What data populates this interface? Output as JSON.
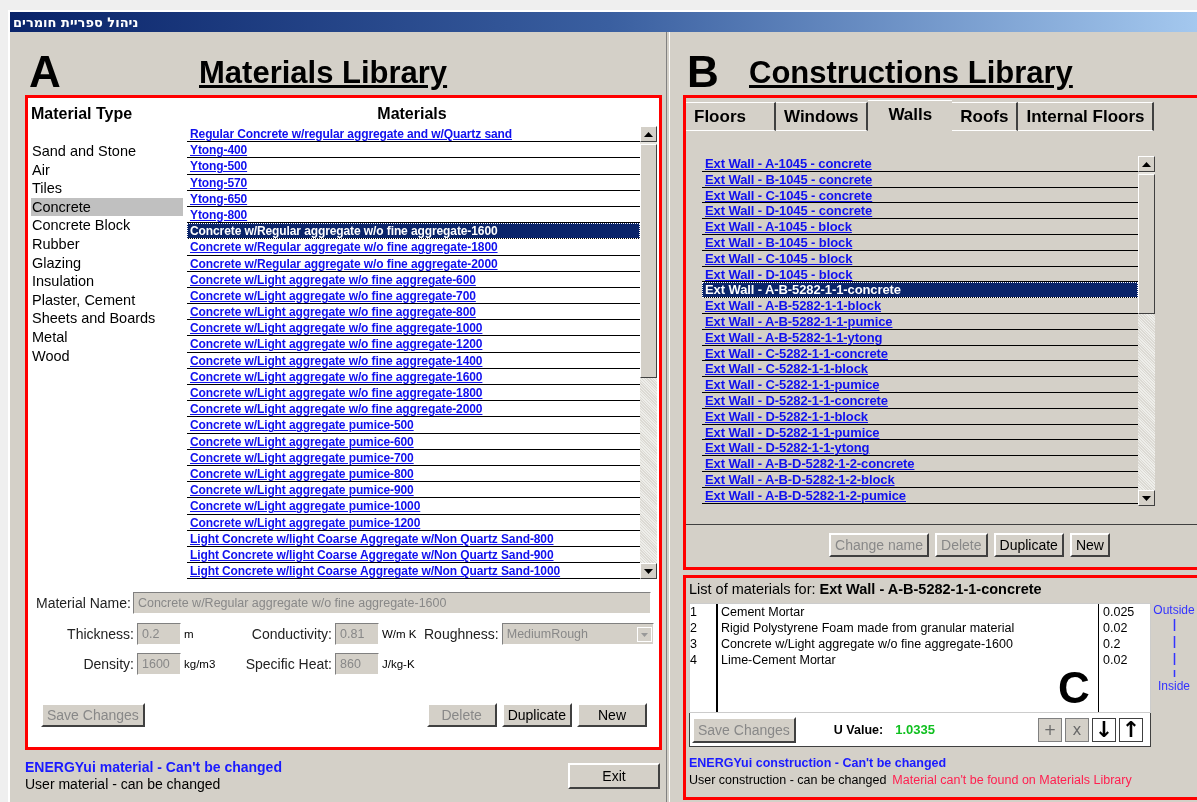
{
  "window": {
    "title": "ניהול ספריית חומרים"
  },
  "materials_library": {
    "letter": "A",
    "title": "Materials Library",
    "type_heading": "Material Type",
    "list_heading": "Materials",
    "types": [
      {
        "label": "Sand and Stone",
        "selected": false
      },
      {
        "label": "Air",
        "selected": false
      },
      {
        "label": "Tiles",
        "selected": false
      },
      {
        "label": "Concrete",
        "selected": true
      },
      {
        "label": "Concrete Block",
        "selected": false
      },
      {
        "label": "Rubber",
        "selected": false
      },
      {
        "label": "Glazing",
        "selected": false
      },
      {
        "label": "Insulation",
        "selected": false
      },
      {
        "label": "Plaster, Cement",
        "selected": false
      },
      {
        "label": "Sheets and Boards",
        "selected": false
      },
      {
        "label": "Metal",
        "selected": false
      },
      {
        "label": "Wood",
        "selected": false
      }
    ],
    "materials": [
      {
        "label": "Regular Concrete w/regular aggregate and w/Quartz sand",
        "selected": false
      },
      {
        "label": "Ytong-400",
        "selected": false
      },
      {
        "label": "Ytong-500",
        "selected": false
      },
      {
        "label": "Ytong-570",
        "selected": false
      },
      {
        "label": "Ytong-650",
        "selected": false
      },
      {
        "label": "Ytong-800",
        "selected": false
      },
      {
        "label": "Concrete w/Regular aggregate w/o fine aggregate-1600",
        "selected": true
      },
      {
        "label": "Concrete w/Regular aggregate w/o fine aggregate-1800",
        "selected": false
      },
      {
        "label": "Concrete w/Regular aggregate w/o fine aggregate-2000",
        "selected": false
      },
      {
        "label": "Concrete w/Light aggregate w/o fine aggregate-600",
        "selected": false
      },
      {
        "label": "Concrete w/Light aggregate w/o fine aggregate-700",
        "selected": false
      },
      {
        "label": "Concrete w/Light aggregate w/o fine aggregate-800",
        "selected": false
      },
      {
        "label": "Concrete w/Light aggregate w/o fine aggregate-1000",
        "selected": false
      },
      {
        "label": "Concrete w/Light aggregate w/o fine aggregate-1200",
        "selected": false
      },
      {
        "label": "Concrete w/Light aggregate w/o fine aggregate-1400",
        "selected": false
      },
      {
        "label": "Concrete w/Light aggregate w/o fine aggregate-1600",
        "selected": false
      },
      {
        "label": "Concrete w/Light aggregate w/o fine aggregate-1800",
        "selected": false
      },
      {
        "label": "Concrete w/Light aggregate w/o fine aggregate-2000",
        "selected": false
      },
      {
        "label": "Concrete w/Light aggregate pumice-500",
        "selected": false
      },
      {
        "label": "Concrete w/Light aggregate pumice-600",
        "selected": false
      },
      {
        "label": "Concrete w/Light aggregate pumice-700",
        "selected": false
      },
      {
        "label": "Concrete w/Light aggregate pumice-800",
        "selected": false
      },
      {
        "label": "Concrete w/Light aggregate pumice-900",
        "selected": false
      },
      {
        "label": "Concrete w/Light aggregate pumice-1000",
        "selected": false
      },
      {
        "label": "Concrete w/Light aggregate pumice-1200",
        "selected": false
      },
      {
        "label": "Light Concrete w/light Coarse Aggregate w/Non Quartz Sand-800",
        "selected": false
      },
      {
        "label": "Light Concrete w/light Coarse Aggregate w/Non Quartz Sand-900",
        "selected": false
      },
      {
        "label": "Light Concrete w/light Coarse Aggregate w/Non Quartz Sand-1000",
        "selected": false
      }
    ],
    "name_field": {
      "label": "Material Name:",
      "value": "Concrete w/Regular aggregate w/o fine aggregate-1600",
      "disabled": true
    },
    "properties": [
      {
        "kind": "text",
        "label": "Thickness:",
        "value": "0.2",
        "unit": "m",
        "disabled": true
      },
      {
        "kind": "text",
        "label": "Conductivity:",
        "value": "0.81",
        "unit": "W/m K",
        "disabled": true
      },
      {
        "kind": "dropdown",
        "label": "Roughness:",
        "value": "MediumRough",
        "disabled": true
      },
      {
        "kind": "text",
        "label": "Density:",
        "value": "1600",
        "unit": "kg/m3",
        "disabled": true
      },
      {
        "kind": "text",
        "label": "Specific Heat:",
        "value": "860",
        "unit": "J/kg-K",
        "disabled": true
      }
    ],
    "buttons": [
      {
        "label": "Save Changes",
        "disabled": true
      },
      {
        "label": "Delete",
        "disabled": true
      },
      {
        "label": "Duplicate",
        "disabled": false
      },
      {
        "label": "New",
        "disabled": false
      }
    ],
    "legend": [
      {
        "kind": "builtin",
        "text": "ENERGYui material - Can't be changed"
      },
      {
        "kind": "user",
        "text": "User material - can be changed"
      }
    ],
    "exit_button": {
      "label": "Exit",
      "disabled": false
    }
  },
  "constructions_library": {
    "letter": "B",
    "title": "Constructions Library",
    "tabs": [
      {
        "label": "Floors",
        "selected": false
      },
      {
        "label": "Windows",
        "selected": false
      },
      {
        "label": "Walls",
        "selected": true
      },
      {
        "label": "Roofs",
        "selected": false
      },
      {
        "label": "Internal Floors",
        "selected": false
      }
    ],
    "items": [
      {
        "label": "Ext Wall - A-1045 - concrete",
        "selected": false
      },
      {
        "label": "Ext Wall - B-1045 - concrete",
        "selected": false
      },
      {
        "label": "Ext Wall - C-1045 - concrete",
        "selected": false
      },
      {
        "label": "Ext Wall - D-1045 - concrete",
        "selected": false
      },
      {
        "label": "Ext Wall - A-1045 - block",
        "selected": false
      },
      {
        "label": "Ext Wall - B-1045 - block",
        "selected": false
      },
      {
        "label": "Ext Wall - C-1045 - block",
        "selected": false
      },
      {
        "label": "Ext Wall - D-1045 - block",
        "selected": false
      },
      {
        "label": "Ext Wall - A-B-5282-1-1-concrete",
        "selected": true
      },
      {
        "label": "Ext Wall - A-B-5282-1-1-block",
        "selected": false
      },
      {
        "label": "Ext Wall - A-B-5282-1-1-pumice",
        "selected": false
      },
      {
        "label": "Ext Wall - A-B-5282-1-1-ytong",
        "selected": false
      },
      {
        "label": "Ext Wall - C-5282-1-1-concrete",
        "selected": false
      },
      {
        "label": "Ext Wall - C-5282-1-1-block",
        "selected": false
      },
      {
        "label": "Ext Wall - C-5282-1-1-pumice",
        "selected": false
      },
      {
        "label": "Ext Wall - D-5282-1-1-concrete",
        "selected": false
      },
      {
        "label": "Ext Wall - D-5282-1-1-block",
        "selected": false
      },
      {
        "label": "Ext Wall - D-5282-1-1-pumice",
        "selected": false
      },
      {
        "label": "Ext Wall - D-5282-1-1-ytong",
        "selected": false
      },
      {
        "label": "Ext Wall - A-B-D-5282-1-2-concrete",
        "selected": false
      },
      {
        "label": "Ext Wall - A-B-D-5282-1-2-block",
        "selected": false
      },
      {
        "label": "Ext Wall - A-B-D-5282-1-2-pumice",
        "selected": false
      }
    ],
    "buttons": [
      {
        "label": "Change name",
        "disabled": true
      },
      {
        "label": "Delete",
        "disabled": true
      },
      {
        "label": "Duplicate",
        "disabled": false
      },
      {
        "label": "New",
        "disabled": false
      }
    ]
  },
  "layers_panel": {
    "heading": "List of materials for:",
    "construction": "Ext Wall - A-B-5282-1-1-concrete",
    "letter": "C",
    "layers": [
      {
        "number": "1",
        "name": "Cement Mortar",
        "thickness": "0.025"
      },
      {
        "number": "2",
        "name": "Rigid Polystyrene Foam made from granular material",
        "thickness": "0.02"
      },
      {
        "number": "3",
        "name": "Concrete w/Light aggregate w/o fine aggregate-1600",
        "thickness": "0.2"
      },
      {
        "number": "4",
        "name": "Lime-Cement Mortar",
        "thickness": "0.02"
      }
    ],
    "outside_label": "Outside",
    "inside_label": "Inside",
    "save_button": {
      "label": "Save Changes",
      "disabled": true
    },
    "u_value_label": "U Value:",
    "u_value": "1.0335",
    "tool_buttons": [
      {
        "label": "+",
        "disabled": true
      },
      {
        "label": "x",
        "disabled": true
      },
      {
        "label": "↓",
        "disabled": false
      },
      {
        "label": "↑",
        "disabled": false
      }
    ],
    "legend": [
      {
        "kind": "builtin",
        "text": "ENERGYui construction - Can't be changed"
      },
      {
        "kind": "user",
        "text": "User construction - can be changed"
      },
      {
        "kind": "missing",
        "text": "Material can't be found on Materials Library"
      }
    ]
  }
}
